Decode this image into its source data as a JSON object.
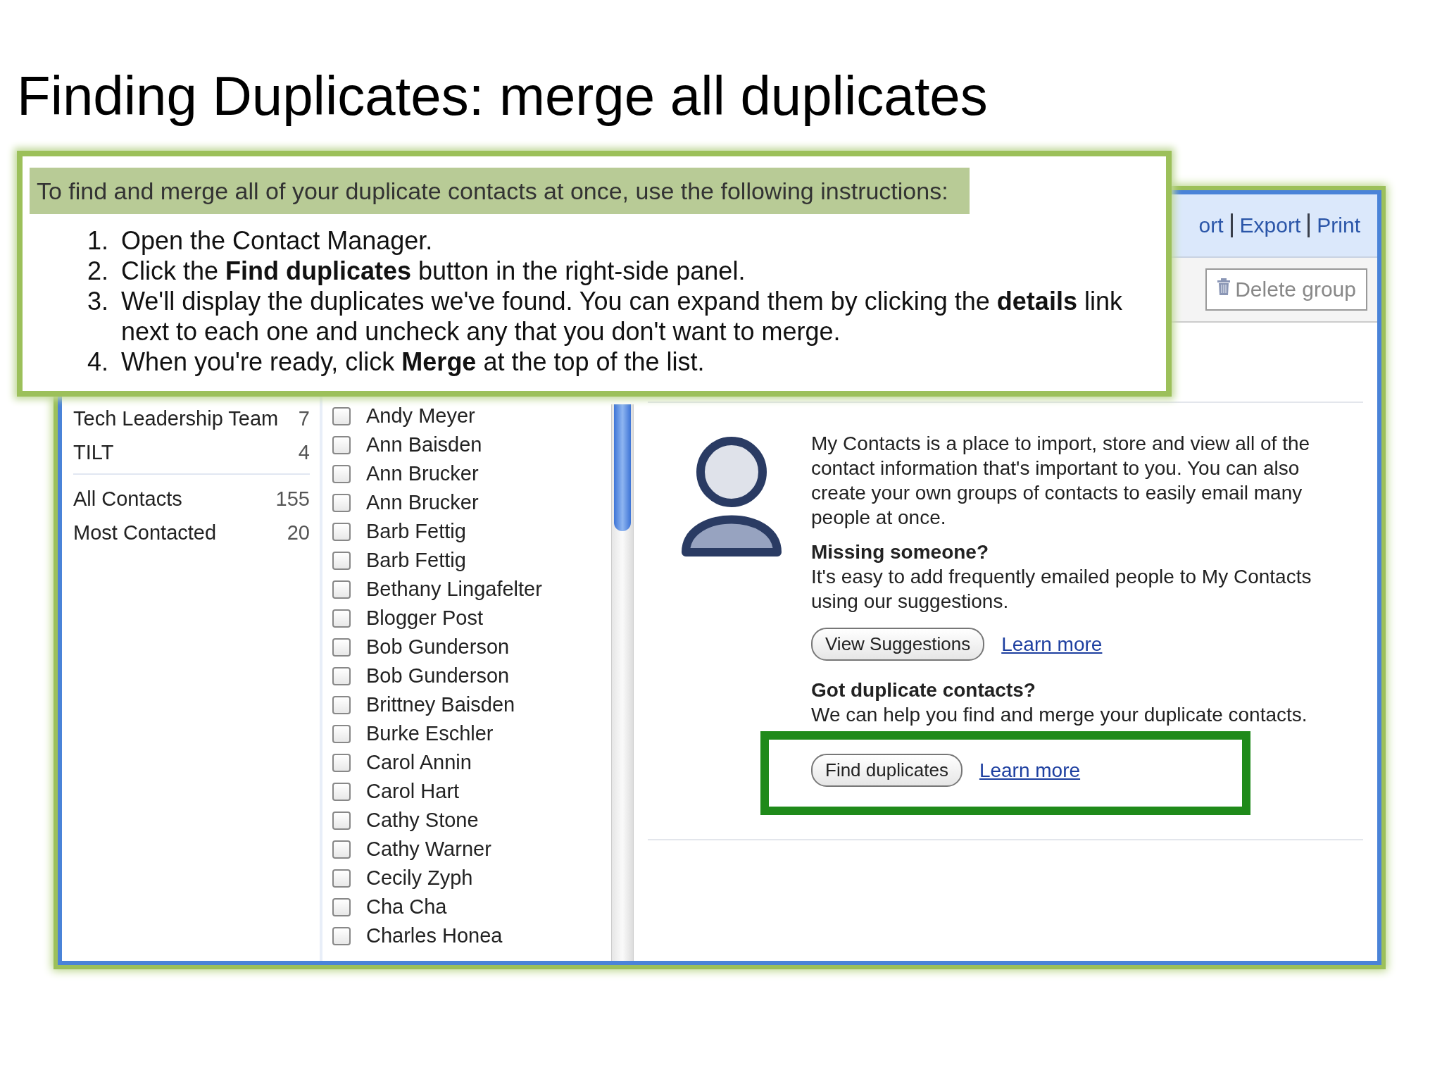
{
  "slide": {
    "title": "Finding Duplicates: merge all duplicates"
  },
  "instructions": {
    "heading": "To find and merge all of your duplicate contacts at once, use the following instructions:",
    "steps": [
      {
        "number": "1.",
        "text": "Open the Contact Manager."
      },
      {
        "number": "2.",
        "text": "Click the **Find duplicates** button in the right-side panel."
      },
      {
        "number": "3.",
        "text": "We'll display the duplicates we've found. You can expand them by clicking the **details** link next to each one and uncheck any that you don't want to merge."
      },
      {
        "number": "4.",
        "text": "When you're ready, click **Merge** at the top of the list."
      }
    ]
  },
  "window": {
    "top_links": [
      "ort",
      "Export",
      "Print"
    ],
    "toolbar": {
      "delete_button": "Delete group"
    },
    "groups": [
      {
        "name": "Tech Leadership Team",
        "count": "7"
      },
      {
        "name": "TILT",
        "count": "4"
      }
    ],
    "system_groups": [
      {
        "name": "All Contacts",
        "count": "155"
      },
      {
        "name": "Most Contacted",
        "count": "20"
      }
    ],
    "contacts": [
      {
        "name": "Andy Meyer",
        "checked": false
      },
      {
        "name": "Ann Baisden",
        "checked": false
      },
      {
        "name": "Ann Brucker",
        "checked": false
      },
      {
        "name": "Ann Brucker",
        "checked": false
      },
      {
        "name": "Barb Fettig",
        "checked": false
      },
      {
        "name": "Barb Fettig",
        "checked": false
      },
      {
        "name": "Bethany Lingafelter",
        "checked": false
      },
      {
        "name": "Blogger Post",
        "checked": false
      },
      {
        "name": "Bob Gunderson",
        "checked": false
      },
      {
        "name": "Bob Gunderson",
        "checked": false
      },
      {
        "name": "Brittney Baisden",
        "checked": false
      },
      {
        "name": "Burke Eschler",
        "checked": false
      },
      {
        "name": "Carol Annin",
        "checked": false
      },
      {
        "name": "Carol Hart",
        "checked": false
      },
      {
        "name": "Cathy Stone",
        "checked": false
      },
      {
        "name": "Cathy Warner",
        "checked": false
      },
      {
        "name": "Cecily Zyph",
        "checked": false
      },
      {
        "name": "Cha Cha",
        "checked": false
      },
      {
        "name": "Charles Honea",
        "checked": false
      }
    ],
    "panel": {
      "intro": "My Contacts is a place to import, store and view all of the contact information that's important to you. You can also create your own groups of contacts to easily email many people at once.",
      "sections": [
        {
          "heading": "Missing someone?",
          "text": "It's easy to add frequently emailed people to My Contacts using our suggestions.",
          "button": "View Suggestions",
          "link": "Learn more",
          "highlighted": false
        },
        {
          "heading": "Got duplicate contacts?",
          "text": "We can help you find and merge your duplicate contacts.",
          "button": "Find duplicates",
          "link": "Learn more",
          "highlighted": true
        }
      ]
    }
  }
}
